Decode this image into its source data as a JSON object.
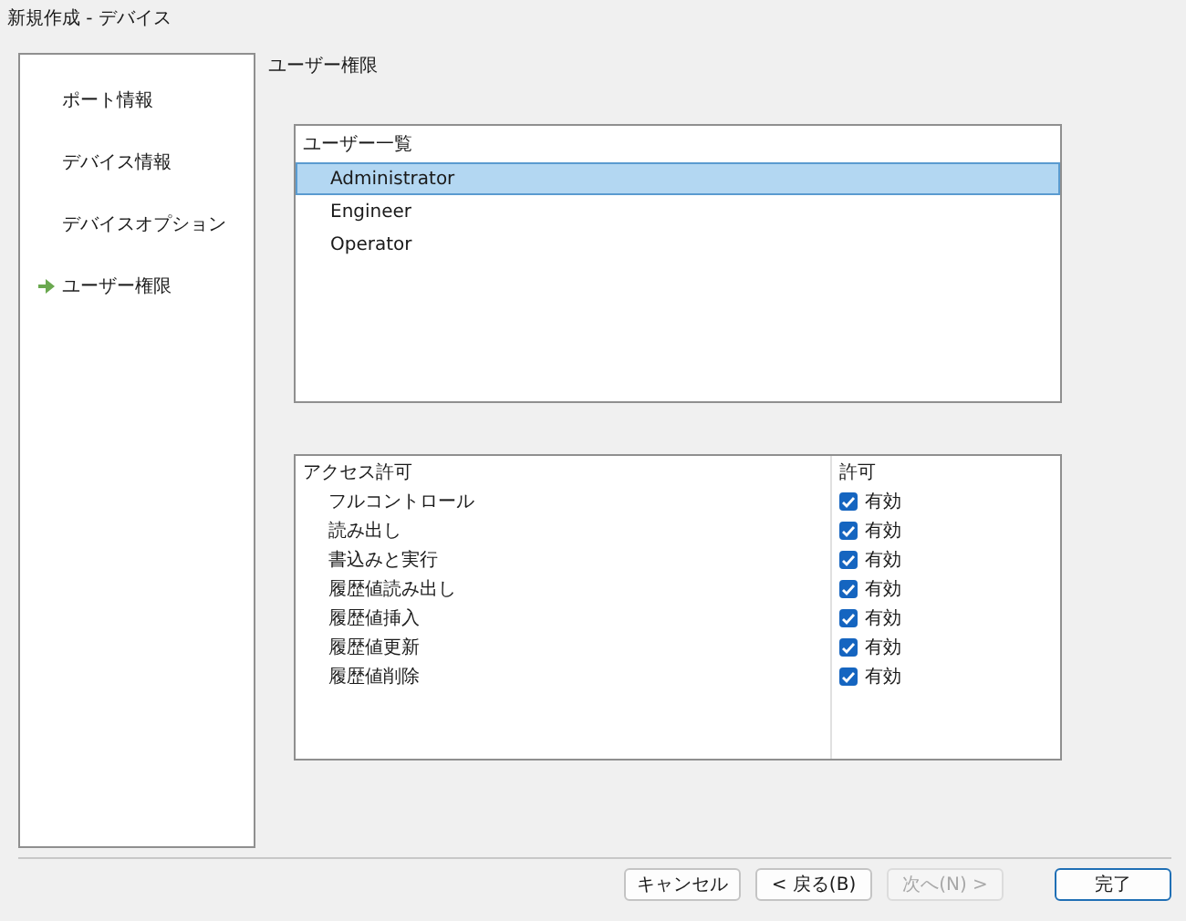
{
  "window": {
    "title": "新規作成 - デバイス"
  },
  "sidebar": {
    "items": [
      {
        "label": "ポート情報",
        "selected": false
      },
      {
        "label": "デバイス情報",
        "selected": false
      },
      {
        "label": "デバイスオプション",
        "selected": false
      },
      {
        "label": "ユーザー権限",
        "selected": true
      }
    ]
  },
  "page_title": "ユーザー権限",
  "user_list": {
    "header": "ユーザー一覧",
    "rows": [
      {
        "name": "Administrator",
        "selected": true
      },
      {
        "name": "Engineer",
        "selected": false
      },
      {
        "name": "Operator",
        "selected": false
      }
    ]
  },
  "permissions": {
    "columns": [
      "アクセス許可",
      "許可"
    ],
    "rows": [
      {
        "name": "フルコントロール",
        "checked": true,
        "value": "有効"
      },
      {
        "name": "読み出し",
        "checked": true,
        "value": "有効"
      },
      {
        "name": "書込みと実行",
        "checked": true,
        "value": "有効"
      },
      {
        "name": "履歴値読み出し",
        "checked": true,
        "value": "有効"
      },
      {
        "name": "履歴値挿入",
        "checked": true,
        "value": "有効"
      },
      {
        "name": "履歴値更新",
        "checked": true,
        "value": "有効"
      },
      {
        "name": "履歴値削除",
        "checked": true,
        "value": "有効"
      }
    ]
  },
  "buttons": [
    {
      "label": "キャンセル",
      "disabled": false,
      "default": false
    },
    {
      "label": "< 戻る(B)",
      "disabled": false,
      "default": false
    },
    {
      "label": "次へ(N) >",
      "disabled": true,
      "default": false
    },
    {
      "label": "完了",
      "disabled": false,
      "default": true
    }
  ]
}
